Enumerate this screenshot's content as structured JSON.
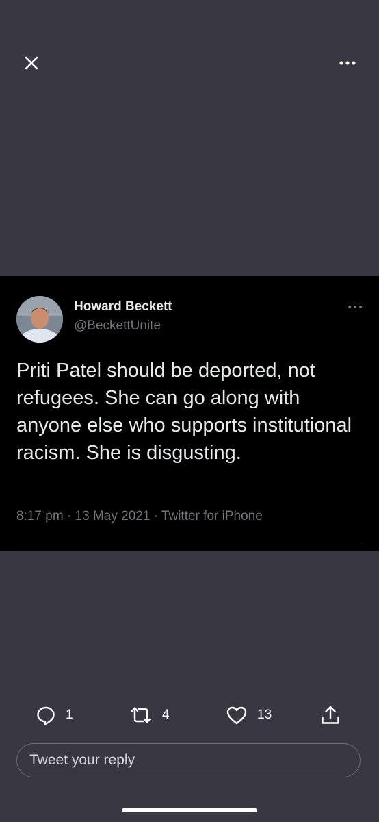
{
  "viewer": {
    "close_icon": "close-icon",
    "more_icon": "more-horizontal-icon"
  },
  "tweet": {
    "author_name": "Howard Beckett",
    "author_handle": "@BeckettUnite",
    "text": "Priti Patel should be deported, not refugees. She can go along with anyone else who supports institutional racism. She is disgusting.",
    "meta": "8:17 pm · 13 May 2021 · Twitter for iPhone"
  },
  "actions": {
    "reply_count": "1",
    "retweet_count": "4",
    "like_count": "13"
  },
  "reply_input": {
    "placeholder": "Tweet your reply"
  },
  "colors": {
    "background": "#393842",
    "tweet_background": "#000000",
    "secondary_text": "#71767b"
  }
}
